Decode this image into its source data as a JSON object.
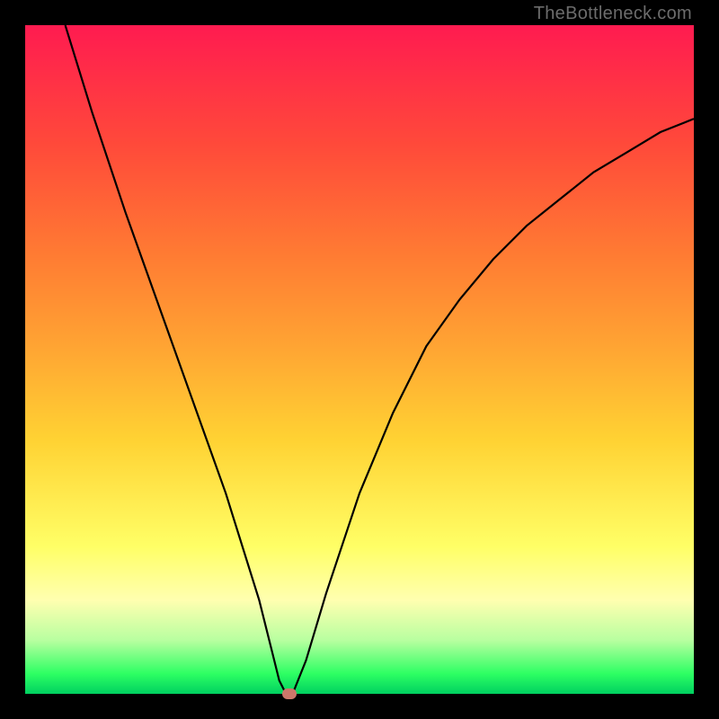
{
  "watermark": "TheBottleneck.com",
  "chart_data": {
    "type": "line",
    "title": "",
    "xlabel": "",
    "ylabel": "",
    "xlim": [
      0,
      100
    ],
    "ylim": [
      0,
      100
    ],
    "x": [
      6,
      10,
      15,
      20,
      25,
      30,
      35,
      37,
      38,
      39,
      40,
      42,
      45,
      50,
      55,
      60,
      65,
      70,
      75,
      80,
      85,
      90,
      95,
      100
    ],
    "values": [
      100,
      87,
      72,
      58,
      44,
      30,
      14,
      6,
      2,
      0,
      0,
      5,
      15,
      30,
      42,
      52,
      59,
      65,
      70,
      74,
      78,
      81,
      84,
      86
    ],
    "marker": {
      "x": 39.5,
      "y": 0
    },
    "grid": false,
    "legend": false
  },
  "colors": {
    "curve": "#000000",
    "marker": "#cc776a",
    "frame": "#000000"
  }
}
